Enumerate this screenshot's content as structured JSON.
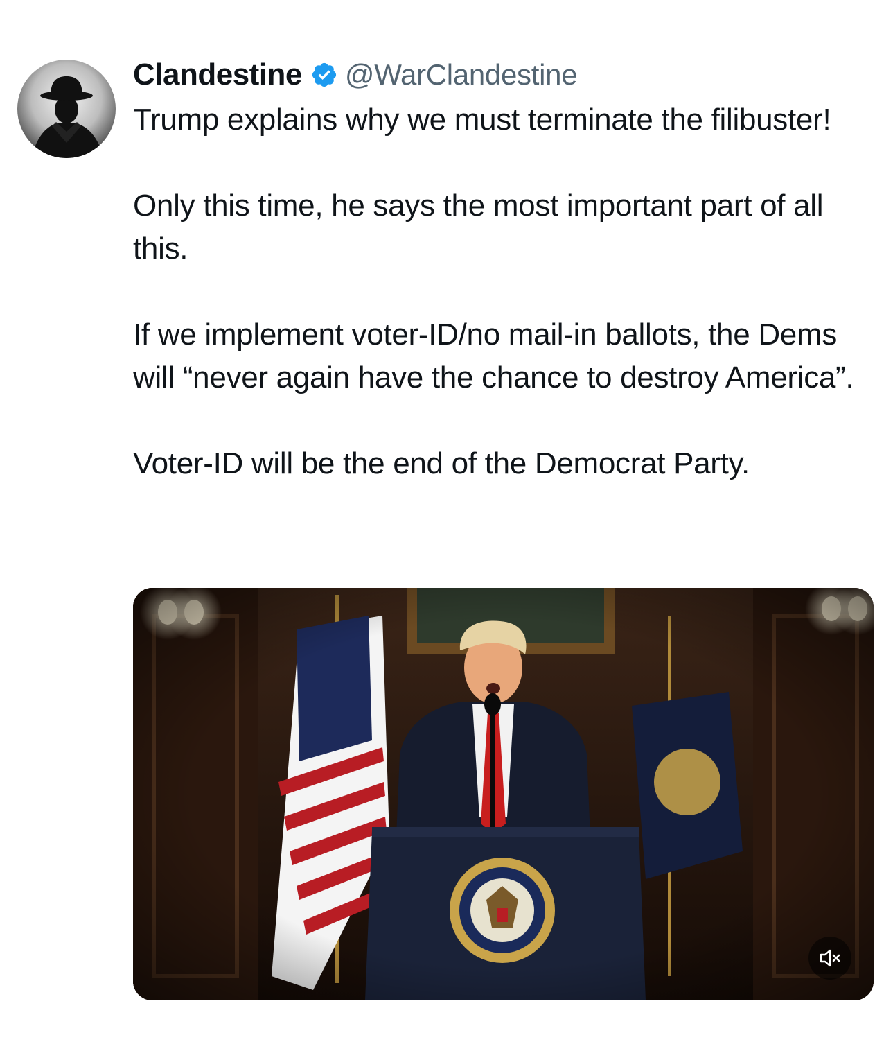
{
  "author": {
    "display_name": "Clandestine",
    "handle": "@WarClandestine",
    "verified": true,
    "avatar_icon": "silhouette-fedora-avatar"
  },
  "post": {
    "paragraphs": [
      "Trump explains why we must terminate the filibuster!",
      "Only this time, he says the most important part of all this.",
      "If we implement voter-ID/no mail-in ballots, the Dems will “never again have the chance to destroy America”.",
      "Voter-ID will be the end of the Democrat Party."
    ]
  },
  "media": {
    "type": "video",
    "muted": true,
    "mute_icon": "speaker-muted-icon"
  },
  "colors": {
    "text": "#0f1419",
    "secondary_text": "#536471",
    "verified_badge": "#1d9bf0"
  }
}
